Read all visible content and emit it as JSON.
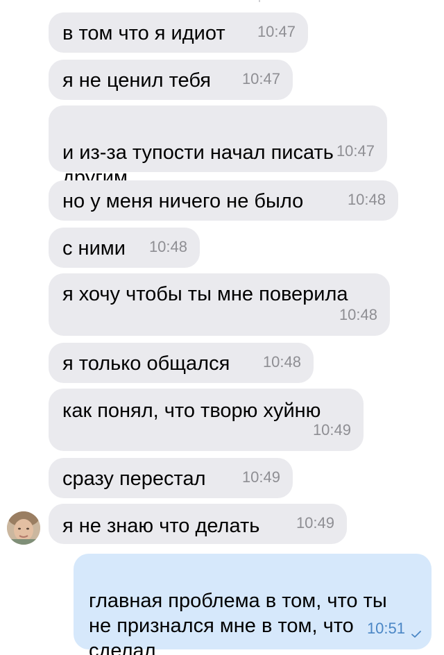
{
  "messages": [
    {
      "text": "в том что я идиот",
      "time": "10:47"
    },
    {
      "text": "я не ценил тебя",
      "time": "10:47"
    },
    {
      "text": "и из-за тупости начал писать\nдругим",
      "time": "10:47"
    },
    {
      "text": "но у меня ничего не было",
      "time": "10:48"
    },
    {
      "text": "с ними",
      "time": "10:48"
    },
    {
      "text": "я хочу чтобы ты мне поверила",
      "time": "10:48"
    },
    {
      "text": "я только общался",
      "time": "10:48"
    },
    {
      "text": "как понял, что творю хуйню",
      "time": "10:49"
    },
    {
      "text": "сразу перестал",
      "time": "10:49"
    },
    {
      "text": "я не знаю что делать",
      "time": "10:49"
    },
    {
      "text": "главная проблема в том, что ты\nне признался мне в том, что\nсделал",
      "time": "10:51"
    }
  ],
  "colors": {
    "incoming_bubble": "#eaeaee",
    "outgoing_bubble": "#d6e8fb",
    "timestamp": "#8e8e93",
    "outgoing_timestamp": "#4a86c5"
  },
  "icons": {
    "read_status": "check-icon",
    "sender_avatar": "avatar"
  }
}
